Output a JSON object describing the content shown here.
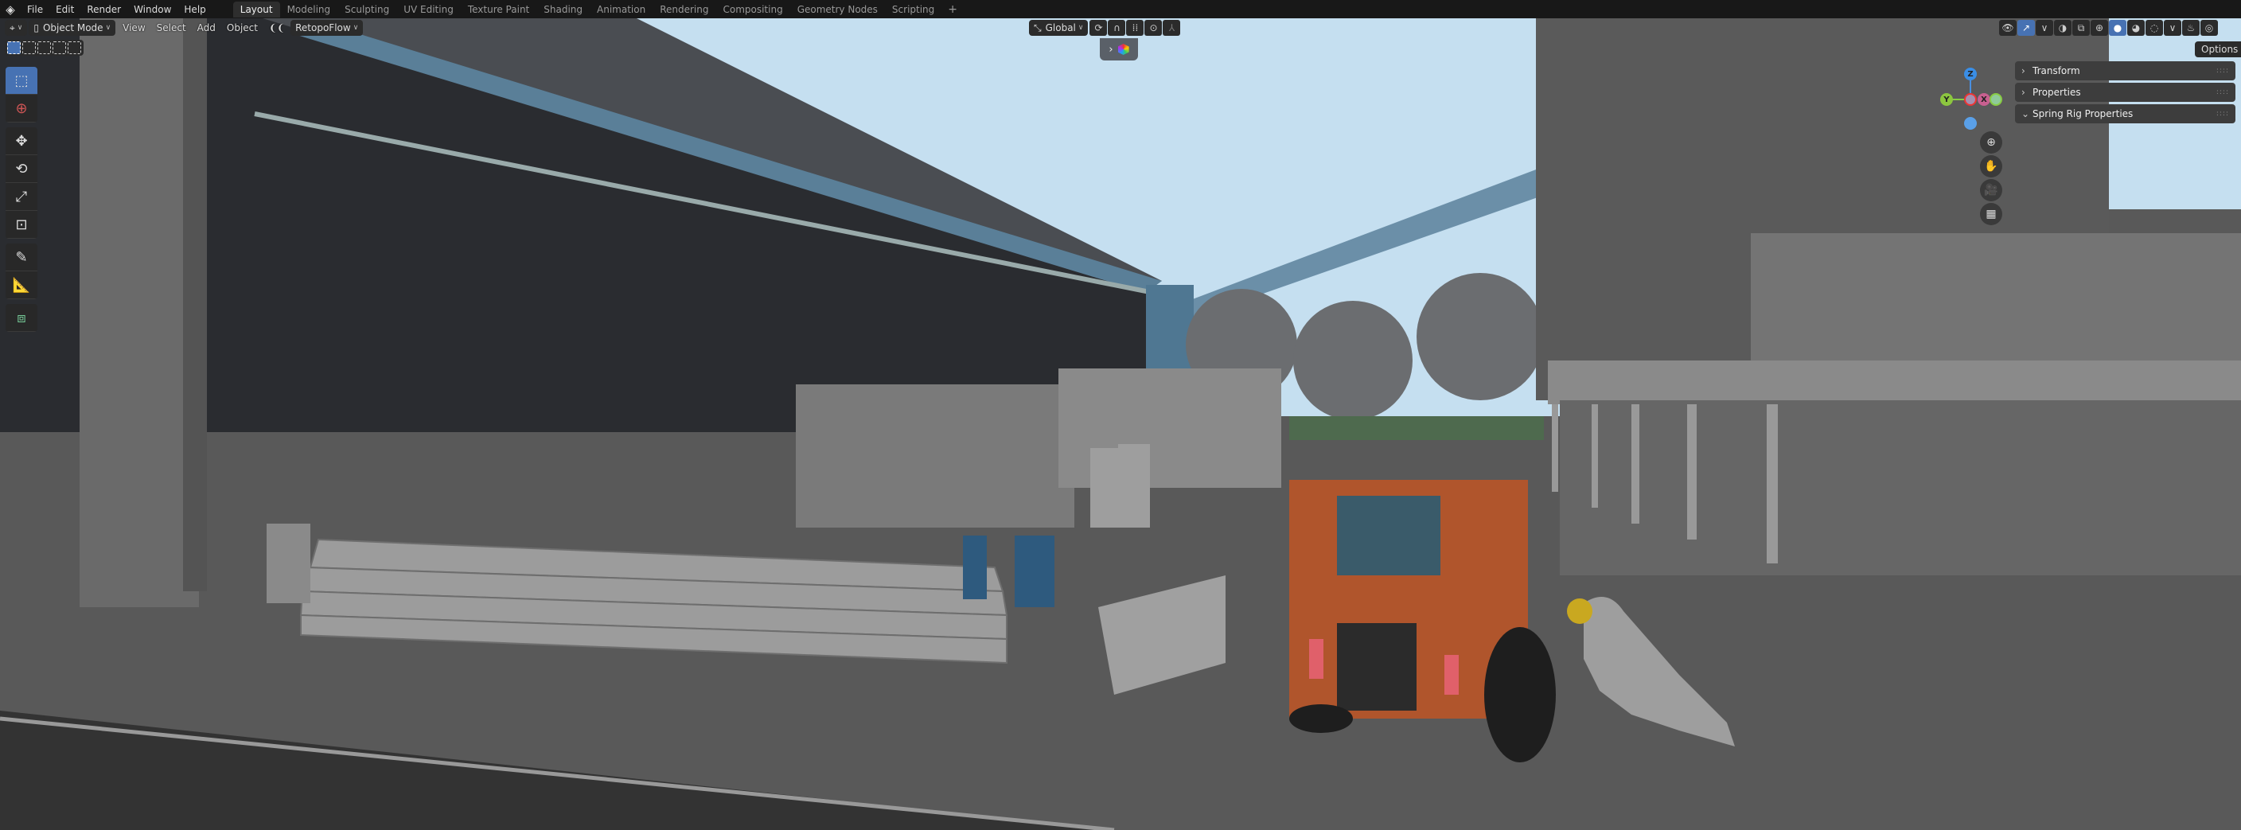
{
  "topbar": {
    "menus": [
      "File",
      "Edit",
      "Render",
      "Window",
      "Help"
    ],
    "workspaces": [
      "Layout",
      "Modeling",
      "Sculpting",
      "UV Editing",
      "Texture Paint",
      "Shading",
      "Animation",
      "Rendering",
      "Compositing",
      "Geometry Nodes",
      "Scripting"
    ],
    "active_workspace": "Layout",
    "add_label": "+"
  },
  "header": {
    "mode": "Object Mode",
    "menus": [
      "View",
      "Select",
      "Add",
      "Object"
    ],
    "addon": "RetopoFlow",
    "orientation": "Global"
  },
  "gizmo": {
    "z": "Z",
    "y": "Y",
    "x": "X"
  },
  "npanel": {
    "options_label": "Options",
    "panels": [
      {
        "label": "Transform",
        "expanded": false
      },
      {
        "label": "Properties",
        "expanded": false
      },
      {
        "label": "Spring Rig Properties",
        "expanded": true
      }
    ]
  },
  "colors": {
    "accent": "#4772b3",
    "sky": "#c5dff0",
    "vehicle": "#b0552c"
  }
}
